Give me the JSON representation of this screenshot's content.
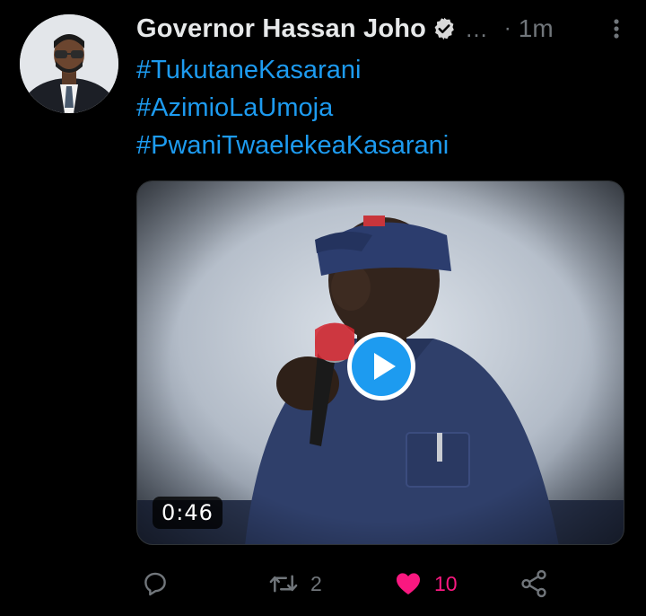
{
  "tweet": {
    "author": {
      "display_name": "Governor Hassan Joho",
      "verified_icon": "verified-badge-icon",
      "truncation": "...",
      "separator": "·",
      "timestamp": "1m"
    },
    "hashtags": [
      "#TukutaneKasarani",
      "#AzimioLaUmoja",
      "#PwaniTwaelekeaKasarani"
    ],
    "media": {
      "type": "video",
      "duration": "0:46",
      "play_icon": "play-icon"
    },
    "actions": {
      "reply": {
        "icon": "reply-icon"
      },
      "retweet": {
        "icon": "retweet-icon",
        "count": "2"
      },
      "like": {
        "icon": "heart-icon",
        "count": "10",
        "liked": true
      },
      "share": {
        "icon": "share-icon"
      }
    }
  },
  "colors": {
    "background": "#000000",
    "text_primary": "#e7e9ea",
    "text_secondary": "#71767b",
    "link": "#1d9bf0",
    "like": "#f91880",
    "play_button": "#1d9bf0"
  }
}
